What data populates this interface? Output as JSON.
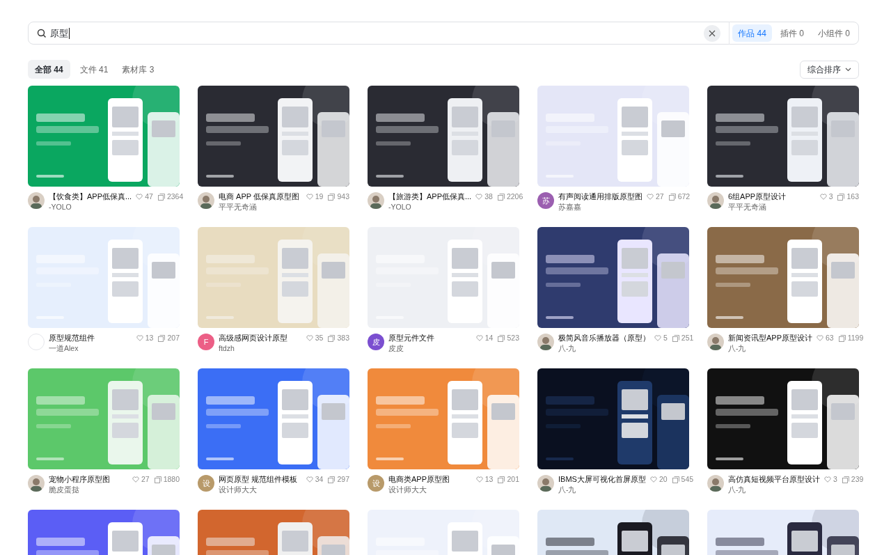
{
  "search": {
    "query": "原型",
    "tabs": [
      {
        "label": "作品",
        "count": "44",
        "selected": true
      },
      {
        "label": "插件",
        "count": "0",
        "selected": false
      },
      {
        "label": "小组件",
        "count": "0",
        "selected": false
      }
    ]
  },
  "filters": [
    {
      "label": "全部",
      "count": "44",
      "selected": true
    },
    {
      "label": "文件",
      "count": "41",
      "selected": false
    },
    {
      "label": "素材库",
      "count": "3",
      "selected": false
    }
  ],
  "sort": {
    "label": "综合排序"
  },
  "cards": [
    {
      "title": "【饮食类】APP低保真...",
      "author": "-YOLO",
      "likes": "47",
      "views": "2364",
      "avatar": {
        "kind": "picture"
      }
    },
    {
      "title": "电商 APP 低保真原型图",
      "author": "平平无奇涵",
      "likes": "19",
      "views": "943",
      "avatar": {
        "kind": "picture"
      }
    },
    {
      "title": "【旅游类】APP低保真...",
      "author": "-YOLO",
      "likes": "38",
      "views": "2206",
      "avatar": {
        "kind": "picture"
      }
    },
    {
      "title": "有声阅读通用排版原型图",
      "author": "苏嘉嘉",
      "likes": "27",
      "views": "672",
      "avatar": {
        "kind": "letter",
        "text": "苏",
        "color": "#9b5fb0"
      }
    },
    {
      "title": "6组APP原型设计",
      "author": "平平无奇涵",
      "likes": "3",
      "views": "163",
      "avatar": {
        "kind": "picture"
      }
    },
    {
      "title": "原型规范组件",
      "author": "一道Alex",
      "likes": "13",
      "views": "207",
      "avatar": {
        "kind": "blank"
      }
    },
    {
      "title": "高级感网页设计原型",
      "author": "ftdzh",
      "likes": "35",
      "views": "383",
      "avatar": {
        "kind": "letter",
        "text": "F",
        "color": "#ec5f86"
      }
    },
    {
      "title": "原型元件文件",
      "author": "皮皮",
      "likes": "14",
      "views": "523",
      "avatar": {
        "kind": "letter",
        "text": "皮",
        "color": "#7b4fd0"
      }
    },
    {
      "title": "极简风音乐播放器（原型）",
      "author": "八-九",
      "likes": "5",
      "views": "251",
      "avatar": {
        "kind": "picture"
      }
    },
    {
      "title": "新闻资讯型APP原型设计",
      "author": "八-九",
      "likes": "63",
      "views": "1199",
      "avatar": {
        "kind": "picture"
      }
    },
    {
      "title": "宠物小程序原型图",
      "author": "脆皮蛋挞",
      "likes": "27",
      "views": "1880",
      "avatar": {
        "kind": "picture"
      }
    },
    {
      "title": "网页原型 规范组件模板",
      "author": "设计师大大",
      "likes": "34",
      "views": "297",
      "avatar": {
        "kind": "letter",
        "text": "设",
        "color": "#b89a6a"
      }
    },
    {
      "title": "电商类APP原型图",
      "author": "设计师大大",
      "likes": "13",
      "views": "201",
      "avatar": {
        "kind": "letter",
        "text": "设",
        "color": "#b89a6a"
      }
    },
    {
      "title": "IBMS大屏可视化首屏原型",
      "author": "八-九",
      "likes": "20",
      "views": "545",
      "avatar": {
        "kind": "picture"
      }
    },
    {
      "title": "高仿真短视频平台原型设计",
      "author": "八-九",
      "likes": "3",
      "views": "239",
      "avatar": {
        "kind": "picture"
      }
    },
    {
      "kind": "picture"
    },
    {
      "kind": "picture"
    },
    {
      "kind": "picture"
    },
    {
      "kind": "picture"
    },
    {
      "kind": "picture"
    }
  ]
}
